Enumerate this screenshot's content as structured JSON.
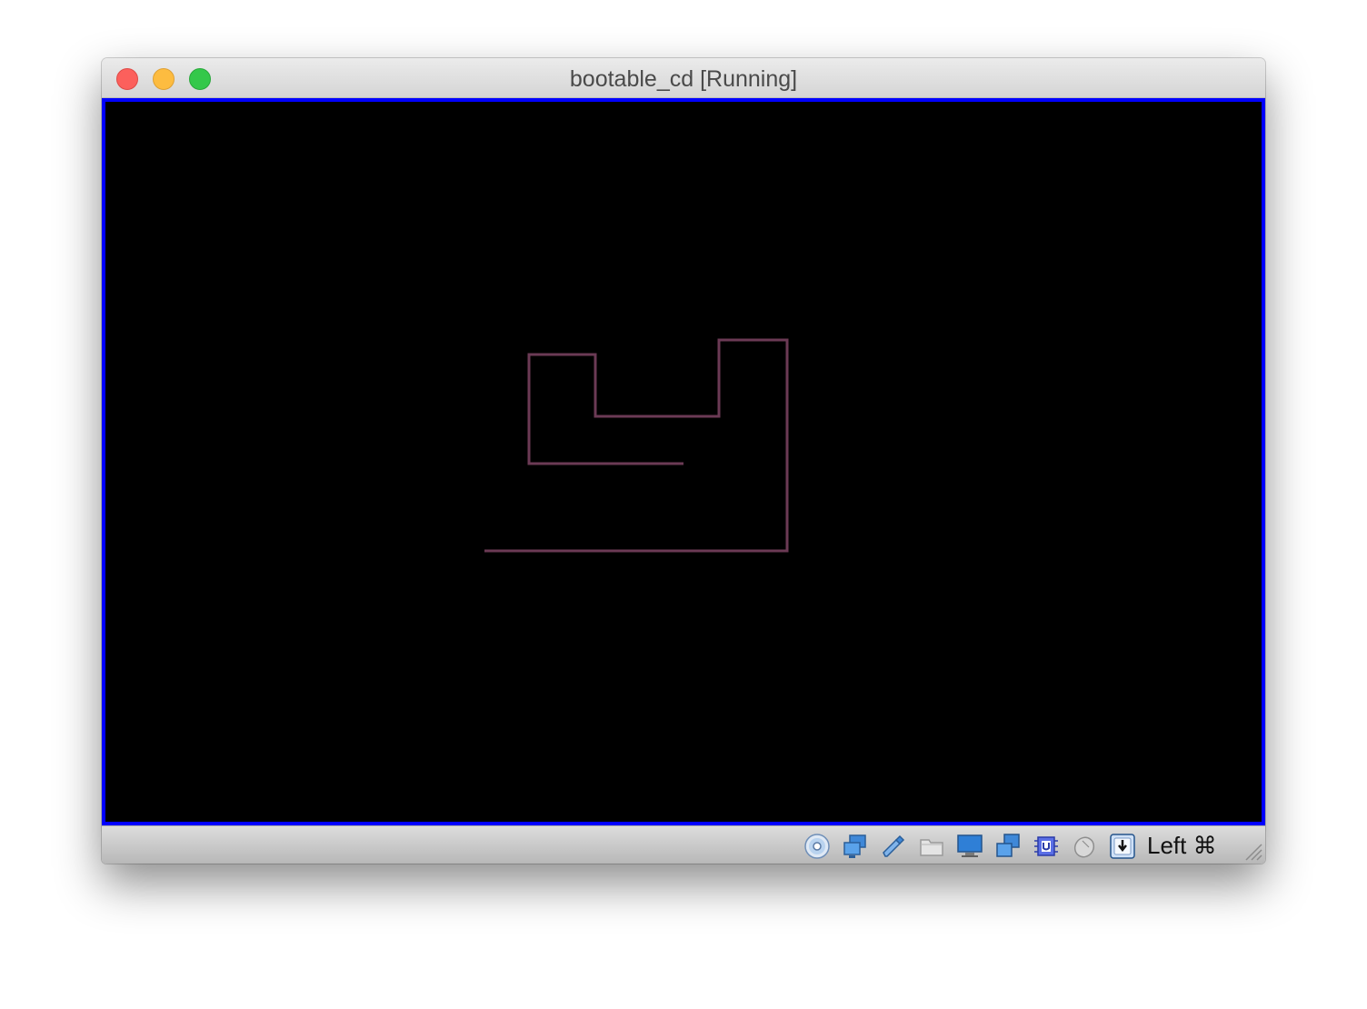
{
  "window": {
    "title": "bootable_cd [Running]"
  },
  "vm_screen": {
    "background": "#000000",
    "frame_color": "#0000ff",
    "drawing_color": "#6b3a55"
  },
  "statusbar": {
    "icons": [
      "optical-disk-icon",
      "network-icon",
      "usb-icon",
      "shared-folders-icon",
      "display-icon",
      "video-capture-icon",
      "cpu-virtualization-icon",
      "mouse-integration-icon",
      "keyboard-capture-icon"
    ],
    "host_key": "Left ⌘"
  }
}
